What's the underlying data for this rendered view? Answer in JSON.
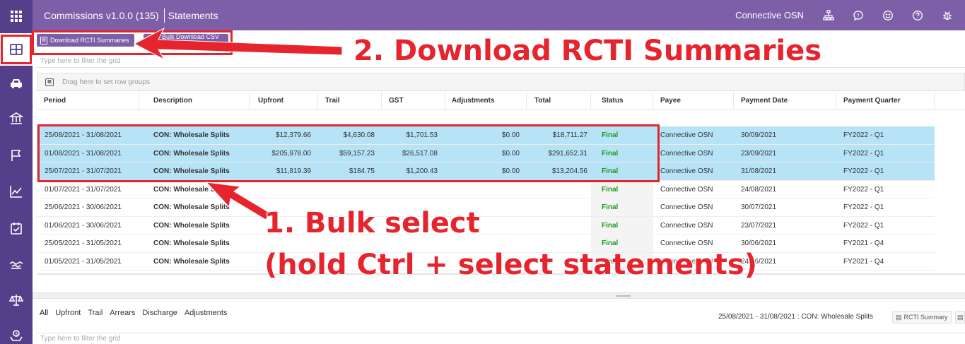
{
  "header": {
    "app_title": "Commissions v1.0.0 (135)",
    "breadcrumb": "Statements",
    "user_name": "Connective OSN"
  },
  "toolbar": {
    "download_rcti_label": "Download RCTI Summaries",
    "csv_export_label": "Bulk Download CSV Export"
  },
  "grid_filter": {
    "placeholder": "Type here to filter the grid"
  },
  "group_bar": {
    "text": "Drag here to set row groups"
  },
  "grid": {
    "columns": [
      "Period",
      "Description",
      "Upfront",
      "Trail",
      "GST",
      "Adjustments",
      "Total",
      "Status",
      "Payee",
      "Payment Date",
      "Payment Quarter"
    ],
    "rows": [
      {
        "period": "25/08/2021 - 31/08/2021",
        "description": "CON: Wholesale Splits",
        "upfront": "$12,379.66",
        "trail": "$4,630.08",
        "gst": "$1,701.53",
        "adjustments": "$0.00",
        "total": "$18,711.27",
        "status": "Final",
        "payee": "Connective OSN",
        "payment_date": "30/09/2021",
        "payment_quarter": "FY2022 - Q1",
        "selected": true
      },
      {
        "period": "01/08/2021 - 31/08/2021",
        "description": "CON: Wholesale Splits",
        "upfront": "$205,978.00",
        "trail": "$59,157.23",
        "gst": "$26,517.08",
        "adjustments": "$0.00",
        "total": "$291,652.31",
        "status": "Final",
        "payee": "Connective OSN",
        "payment_date": "23/09/2021",
        "payment_quarter": "FY2022 - Q1",
        "selected": true
      },
      {
        "period": "25/07/2021 - 31/07/2021",
        "description": "CON: Wholesale Splits",
        "upfront": "$11,819.39",
        "trail": "$184.75",
        "gst": "$1,200.43",
        "adjustments": "$0.00",
        "total": "$13,204.56",
        "status": "Final",
        "payee": "Connective OSN",
        "payment_date": "31/08/2021",
        "payment_quarter": "FY2022 - Q1",
        "selected": true
      },
      {
        "period": "01/07/2021 - 31/07/2021",
        "description": "CON: Wholesale Splits",
        "upfront": "",
        "trail": "",
        "gst": "",
        "adjustments": "",
        "total": "",
        "status": "Final",
        "payee": "Connective OSN",
        "payment_date": "24/08/2021",
        "payment_quarter": "FY2022 - Q1",
        "selected": false
      },
      {
        "period": "25/06/2021 - 30/06/2021",
        "description": "CON: Wholesale Splits",
        "upfront": "",
        "trail": "",
        "gst": "",
        "adjustments": "",
        "total": "",
        "status": "Final",
        "payee": "Connective OSN",
        "payment_date": "30/07/2021",
        "payment_quarter": "FY2022 - Q1",
        "selected": false
      },
      {
        "period": "01/06/2021 - 30/06/2021",
        "description": "CON: Wholesale Splits",
        "upfront": "",
        "trail": "",
        "gst": "",
        "adjustments": "",
        "total": "",
        "status": "Final",
        "payee": "Connective OSN",
        "payment_date": "23/07/2021",
        "payment_quarter": "FY2022 - Q1",
        "selected": false
      },
      {
        "period": "25/05/2021 - 31/05/2021",
        "description": "CON: Wholesale Splits",
        "upfront": "",
        "trail": "",
        "gst": "",
        "adjustments": "",
        "total": "",
        "status": "Final",
        "payee": "Connective OSN",
        "payment_date": "30/06/2021",
        "payment_quarter": "FY2021 - Q4",
        "selected": false
      },
      {
        "period": "01/05/2021 - 31/05/2021",
        "description": "CON: Wholesale Splits",
        "upfront": "",
        "trail": "",
        "gst": "",
        "adjustments": "",
        "total": "",
        "status": "Final",
        "payee": "Connective OSN",
        "payment_date": "24/06/2021",
        "payment_quarter": "FY2021 - Q4",
        "selected": false
      }
    ]
  },
  "bottom_panel": {
    "tabs": [
      "All",
      "Upfront",
      "Trail",
      "Arrears",
      "Discharge",
      "Adjustments"
    ],
    "selected_label": "25/08/2021 - 31/08/2021 : CON: Wholesale Splits",
    "rcti_summary_label": "RCTI Summary",
    "filter_placeholder": "Type here to filter the grid"
  },
  "annotations": {
    "step2": "2. Download RCTI Summaries",
    "step1_line1": "1. Bulk select",
    "step1_line2": "(hold Ctrl + select statements)"
  },
  "colors": {
    "rail": "#54408a",
    "header": "#7d5fa8",
    "selected_row": "#b7e3f7",
    "status_final": "#1f9a1f",
    "annotation": "#e5242d"
  },
  "icons": {
    "rail": [
      "apps-grid-icon",
      "dashboard-icon",
      "car-icon",
      "bank-icon",
      "flag-icon",
      "trend-chart-icon",
      "calendar-check-icon",
      "handshake-icon",
      "scales-icon",
      "money-hand-icon"
    ],
    "header": [
      "org-chart-icon",
      "chat-icon",
      "smiley-icon",
      "help-icon",
      "bug-icon"
    ]
  }
}
